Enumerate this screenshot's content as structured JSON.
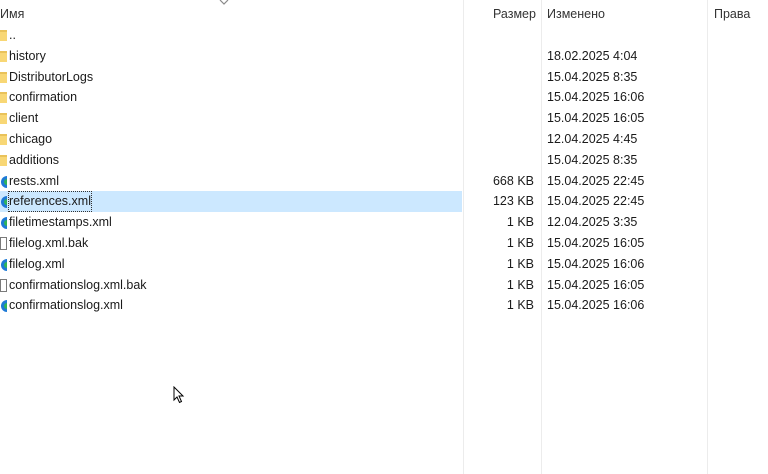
{
  "columns": {
    "name": "Имя",
    "size": "Размер",
    "modified": "Изменено",
    "rights": "Права"
  },
  "files": [
    {
      "name": "..",
      "size": "",
      "date": "",
      "icon": "folder-icon"
    },
    {
      "name": "history",
      "size": "",
      "date": "18.02.2025 4:04",
      "icon": "folder-icon"
    },
    {
      "name": "DistributorLogs",
      "size": "",
      "date": "15.04.2025 8:35",
      "icon": "folder-icon"
    },
    {
      "name": "confirmation",
      "size": "",
      "date": "15.04.2025 16:06",
      "icon": "folder-icon"
    },
    {
      "name": "client",
      "size": "",
      "date": "15.04.2025 16:05",
      "icon": "folder-icon"
    },
    {
      "name": "chicago",
      "size": "",
      "date": "12.04.2025 4:45",
      "icon": "folder-icon"
    },
    {
      "name": "additions",
      "size": "",
      "date": "15.04.2025 8:35",
      "icon": "folder-icon"
    },
    {
      "name": "rests.xml",
      "size": "668 KB",
      "date": "15.04.2025 22:45",
      "icon": "xml-file-icon"
    },
    {
      "name": "references.xml",
      "size": "123 KB",
      "date": "15.04.2025 22:45",
      "icon": "xml-file-icon",
      "selected": true
    },
    {
      "name": "filetimestamps.xml",
      "size": "1 KB",
      "date": "12.04.2025 3:35",
      "icon": "xml-file-icon"
    },
    {
      "name": "filelog.xml.bak",
      "size": "1 KB",
      "date": "15.04.2025 16:05",
      "icon": "document-icon"
    },
    {
      "name": "filelog.xml",
      "size": "1 KB",
      "date": "15.04.2025 16:06",
      "icon": "xml-file-icon"
    },
    {
      "name": "confirmationslog.xml.bak",
      "size": "1 KB",
      "date": "15.04.2025 16:05",
      "icon": "document-icon"
    },
    {
      "name": "confirmationslog.xml",
      "size": "1 KB",
      "date": "15.04.2025 16:06",
      "icon": "xml-file-icon"
    }
  ],
  "colors": {
    "selection": "#cce8ff",
    "folder": "#f8d775",
    "xml_icon": "#1e7ad6"
  }
}
